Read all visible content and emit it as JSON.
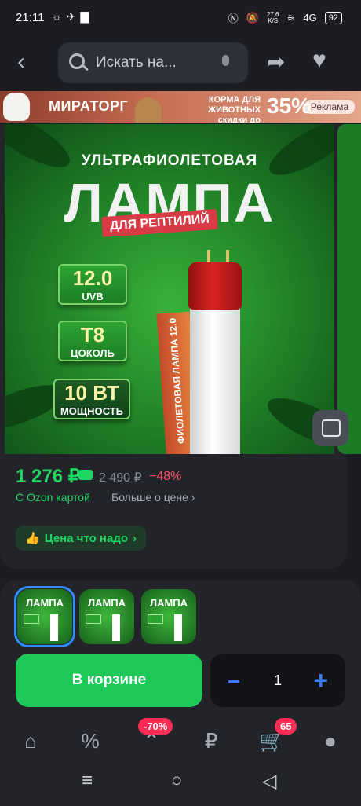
{
  "status_bar": {
    "time": "21:11",
    "net_speed_value": "27,6",
    "net_speed_unit": "K/S",
    "network": "4G",
    "battery": "92"
  },
  "top_bar": {
    "search_placeholder": "Искать на..."
  },
  "ad_banner": {
    "brand": "МИРАТОРГ",
    "promo_line1": "КОРМА ДЛЯ ЖИВОТНЫХ",
    "promo_line2": "скидки до",
    "promo_percent": "35%",
    "ad_label": "Реклама"
  },
  "product_image": {
    "subtitle": "УЛЬТРАФИОЛЕТОВАЯ",
    "title": "ЛАМПА",
    "ribbon": "ДЛЯ РЕПТИЛИЙ",
    "specs": [
      {
        "value": "12.0",
        "label": "UVB"
      },
      {
        "value": "T8",
        "label": "ЦОКОЛЬ"
      },
      {
        "value": "10 ВТ",
        "label": "МОЩНОСТЬ"
      }
    ],
    "box_text": "ФИОЛЕТОВАЯ ЛАМПА 12.0"
  },
  "price": {
    "current": "1 276 ₽",
    "old": "2 490 ₽",
    "discount": "−48%",
    "ozon_card": "С Ozon картой",
    "more_price": "Больше о цене"
  },
  "badge_price": "Цена что надо",
  "thumbnails": [
    {
      "title": "ЛАМПА",
      "selected": true
    },
    {
      "title": "ЛАМПА",
      "selected": false
    },
    {
      "title": "ЛАМПА",
      "selected": false
    }
  ],
  "actions": {
    "cart_label": "В корзине",
    "quantity": "1",
    "minus": "−",
    "plus": "+"
  },
  "tab_bar": {
    "discount_badge": "-70%",
    "cart_badge": "65",
    "active_tab": "cart",
    "accent_color": "#2f8cff"
  },
  "colors": {
    "background": "#1c1d22",
    "green_price": "#1ed760",
    "cart_button": "#1ec95a",
    "discount_red": "#ff4f66"
  }
}
